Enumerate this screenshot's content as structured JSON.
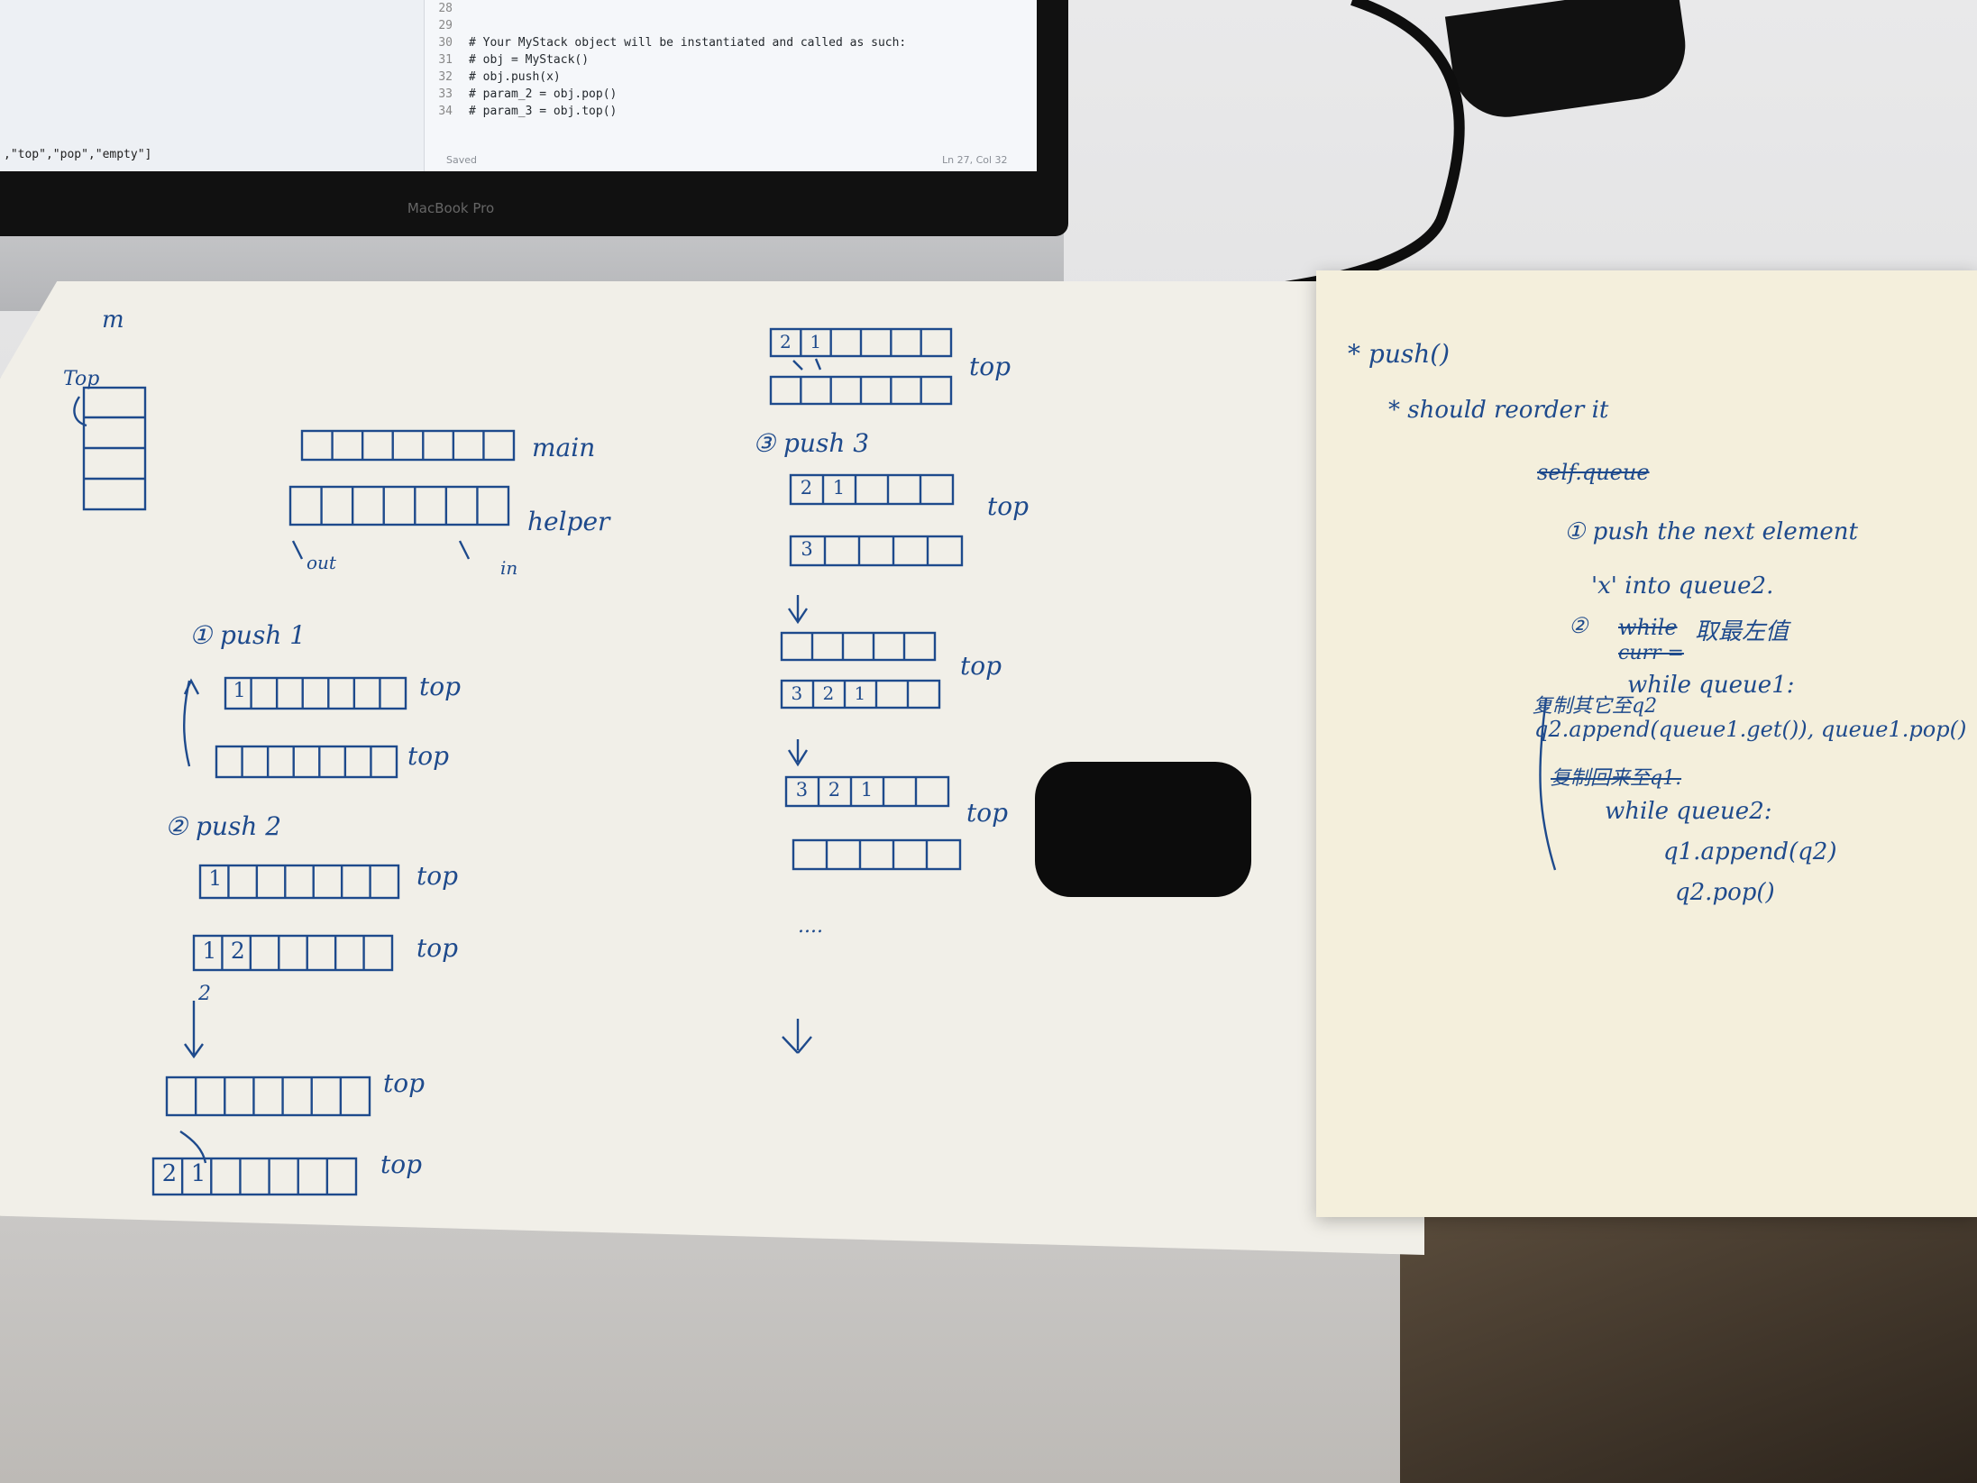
{
  "screen": {
    "code_lines": [
      {
        "n": "28",
        "code": ""
      },
      {
        "n": "29",
        "code": ""
      },
      {
        "n": "30",
        "code": "# Your MyStack object will be instantiated and called as such:"
      },
      {
        "n": "31",
        "code": "# obj = MyStack()"
      },
      {
        "n": "32",
        "code": "# obj.push(x)"
      },
      {
        "n": "33",
        "code": "# param_2 = obj.pop()"
      },
      {
        "n": "34",
        "code": "# param_3 = obj.top()"
      }
    ],
    "output_text": ",\"top\",\"pop\",\"empty\"]",
    "saved": "Saved",
    "cursor": "Ln 27, Col 32"
  },
  "laptop": {
    "brand": "MacBook Pro"
  },
  "notes_left": {
    "corner_mark": "m",
    "stack_label": "Top",
    "main_label": "main",
    "helper_label": "helper",
    "out_label": "out",
    "in_label": "in",
    "step1": "① push 1",
    "step2": "② push 2",
    "step3": "③ push 3",
    "top": "top",
    "ellipsis": "....",
    "cells": {
      "s1a": [
        "1"
      ],
      "s2a": [
        "1"
      ],
      "s2b": [
        "1",
        "2"
      ],
      "s2c": [
        "2",
        "1"
      ],
      "m0a": [
        "2",
        "1"
      ],
      "s3a": [
        "2",
        "1"
      ],
      "s3b": [
        "3"
      ],
      "s3c": [
        "3",
        "2",
        "1"
      ],
      "s3d": [
        "3",
        "2",
        "1"
      ]
    },
    "below2": "2"
  },
  "notes_right": {
    "title": "* push()",
    "line1": "* should reorder it",
    "struck1": "self.queue",
    "item1": "① push the next element",
    "item1b": "'x' into queue2.",
    "item2_num": "②",
    "item2_struck": "while",
    "item2_text": "取最左值",
    "struck2": "curr =",
    "while1": "while queue1:",
    "note_cn": "复制其它至q2",
    "append1": "q2.append(queue1.get()), queue1.pop()",
    "struck3": "复制回来至q1.",
    "while2": "while queue2:",
    "append2": "q1.append(q2)",
    "pop2": "q2.pop()"
  }
}
